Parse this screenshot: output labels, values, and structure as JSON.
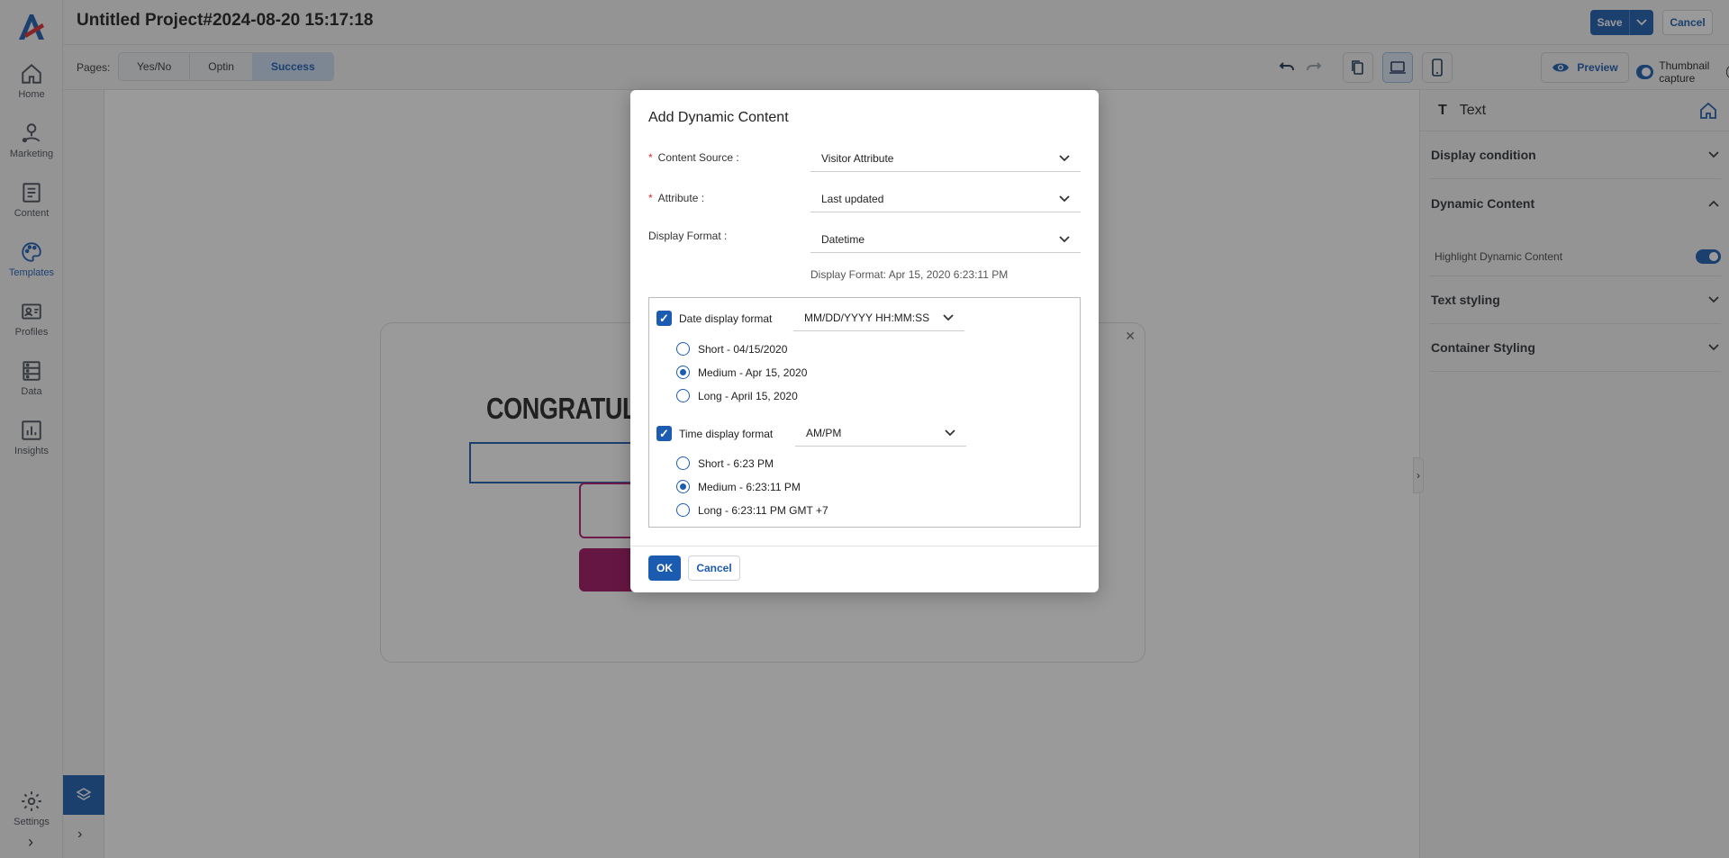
{
  "nav": {
    "items": [
      {
        "label": "Home",
        "icon": "home-icon"
      },
      {
        "label": "Marketing",
        "icon": "marketing-icon"
      },
      {
        "label": "Content",
        "icon": "content-icon"
      },
      {
        "label": "Templates",
        "icon": "palette-icon",
        "active": true
      },
      {
        "label": "Profiles",
        "icon": "profiles-icon"
      },
      {
        "label": "Data",
        "icon": "data-icon"
      },
      {
        "label": "Insights",
        "icon": "insights-icon"
      }
    ],
    "settings_label": "Settings"
  },
  "header": {
    "title": "Untitled Project#2024-08-20 15:17:18",
    "save_label": "Save",
    "cancel_label": "Cancel"
  },
  "toolbar": {
    "pages_label": "Pages:",
    "pages": [
      "Yes/No",
      "Optin",
      "Success"
    ],
    "active_page": "Success",
    "preview_label": "Preview",
    "thumbnail_label": "Thumbnail capture",
    "thumbnail_enabled": true
  },
  "canvas": {
    "popup_heading": "CONGRATULA"
  },
  "right_panel": {
    "title": "Text",
    "sections": [
      {
        "label": "Display condition",
        "expanded": false
      },
      {
        "label": "Dynamic Content",
        "expanded": true
      },
      {
        "label": "Text styling",
        "expanded": false
      },
      {
        "label": "Container Styling",
        "expanded": false
      }
    ],
    "highlight_label": "Highlight Dynamic Content",
    "highlight_enabled": true
  },
  "modal": {
    "title": "Add Dynamic Content",
    "content_source": {
      "label": "Content Source",
      "value": "Visitor Attribute"
    },
    "attribute": {
      "label": "Attribute",
      "value": "Last updated"
    },
    "display_format": {
      "label": "Display Format",
      "value": "Datetime"
    },
    "format_hint": "Display Format: Apr 15, 2020 6:23:11 PM",
    "date_format": {
      "label": "Date display format",
      "checked": true,
      "select_value": "MM/DD/YYYY HH:MM:SS",
      "options": [
        {
          "label": "Short - 04/15/2020",
          "checked": false
        },
        {
          "label": "Medium - Apr 15, 2020",
          "checked": true
        },
        {
          "label": "Long - April 15, 2020",
          "checked": false
        }
      ]
    },
    "time_format": {
      "label": "Time display format",
      "checked": true,
      "select_value": "AM/PM",
      "options": [
        {
          "label": "Short - 6:23 PM",
          "checked": false
        },
        {
          "label": "Medium - 6:23:11 PM",
          "checked": true
        },
        {
          "label": "Long - 6:23:11 PM GMT +7",
          "checked": false
        }
      ]
    },
    "ok_label": "OK",
    "cancel_label": "Cancel"
  },
  "colors": {
    "accent": "#1b5bb0",
    "popup_button": "#a0105f",
    "required": "#e0262b"
  }
}
